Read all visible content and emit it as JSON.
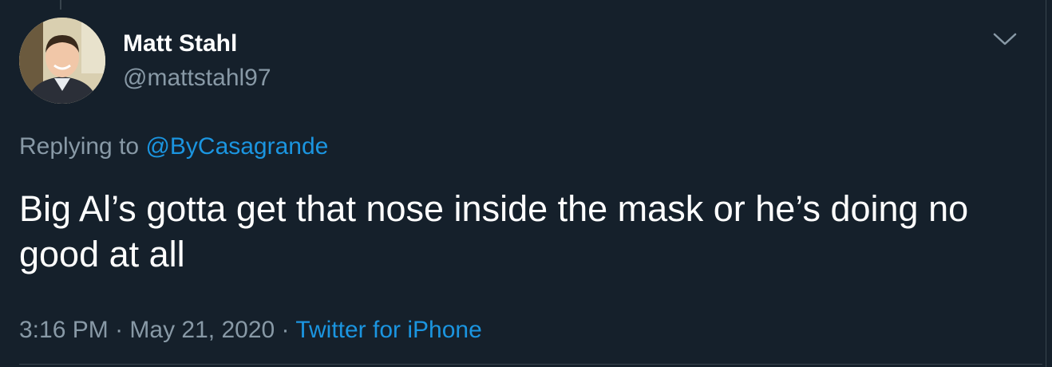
{
  "tweet": {
    "author": {
      "display_name": "Matt Stahl",
      "handle": "@mattstahl97"
    },
    "reply": {
      "prefix": "Replying to ",
      "mention": "@ByCasagrande"
    },
    "text": "Big Al’s gotta get that nose inside the mask or he’s doing no good at all",
    "meta": {
      "time": "3:16 PM",
      "separator": " · ",
      "date": "May 21, 2020",
      "source": "Twitter for iPhone"
    },
    "icons": {
      "menu": "chevron-down-icon"
    }
  },
  "colors": {
    "background": "#15202b",
    "text_primary": "#ffffff",
    "text_secondary": "#8899a6",
    "link": "#1b95e0",
    "border": "#38444d"
  }
}
